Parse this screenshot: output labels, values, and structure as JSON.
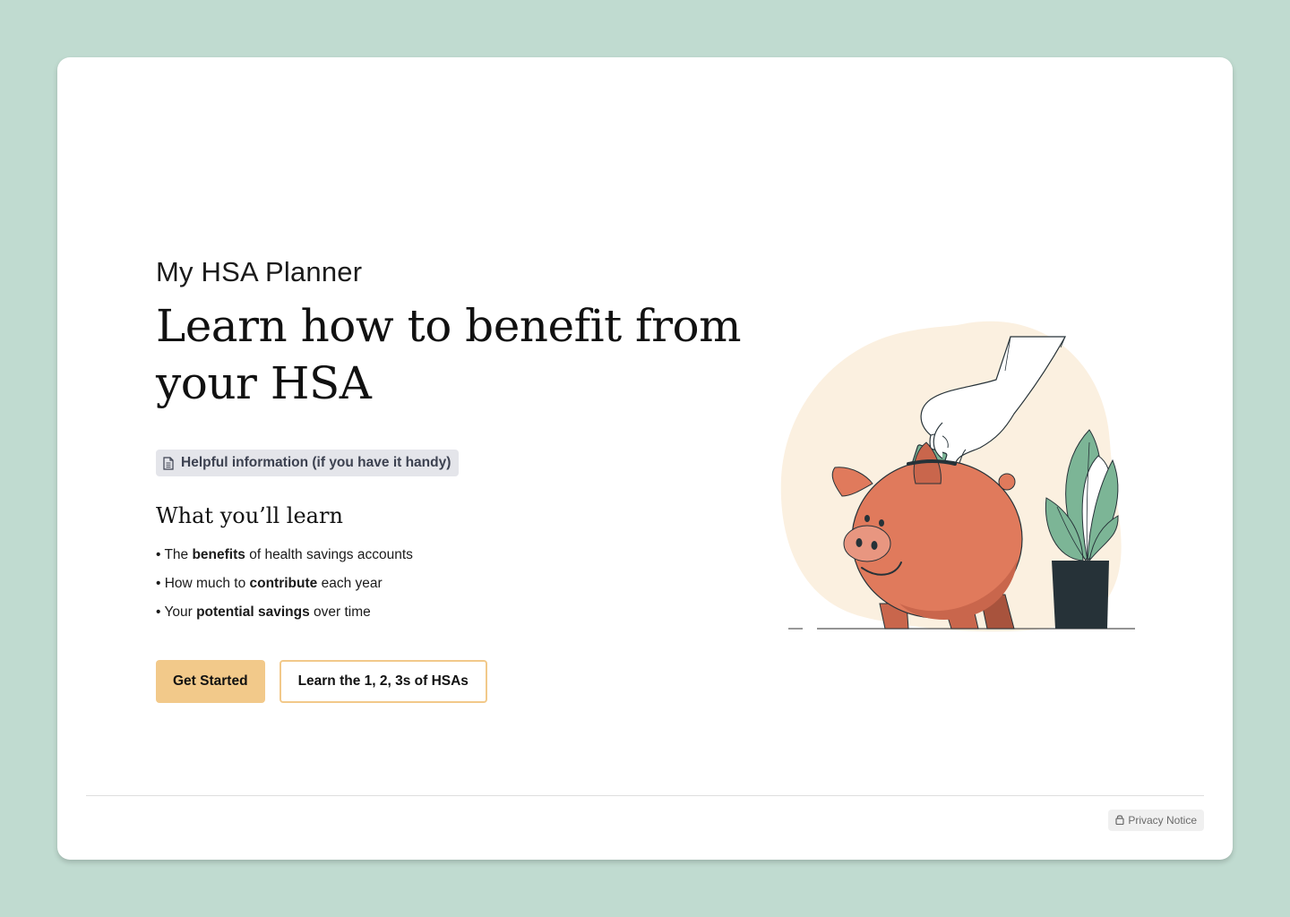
{
  "app_name": "My HSA Planner",
  "headline": {
    "line1": "Learn how to benefit from",
    "line2": "your HSA"
  },
  "info_chip": {
    "label": "Helpful information (if you have it handy)",
    "icon": "document-icon"
  },
  "learn_section": {
    "title": "What you’ll learn",
    "items": [
      {
        "bullet": "• ",
        "pre": "The ",
        "bold": "benefits",
        "post": " of health savings accounts"
      },
      {
        "bullet": "• ",
        "pre": "How much to ",
        "bold": "contribute",
        "post": " each year"
      },
      {
        "bullet": "• ",
        "pre": "Your ",
        "bold": "potential savings",
        "post": " over time"
      }
    ]
  },
  "actions": {
    "primary_label": "Get Started",
    "secondary_label": "Learn the 1, 2, 3s of HSAs"
  },
  "footer": {
    "privacy_label": "Privacy Notice",
    "privacy_icon": "lock-icon"
  },
  "colors": {
    "page_bg": "#c0dbd0",
    "accent": "#f2c98a",
    "chip_bg": "#e4e5ea",
    "pig": "#e07a5c",
    "blob": "#fbf0e0",
    "plant": "#7cb596",
    "pot": "#263238"
  }
}
